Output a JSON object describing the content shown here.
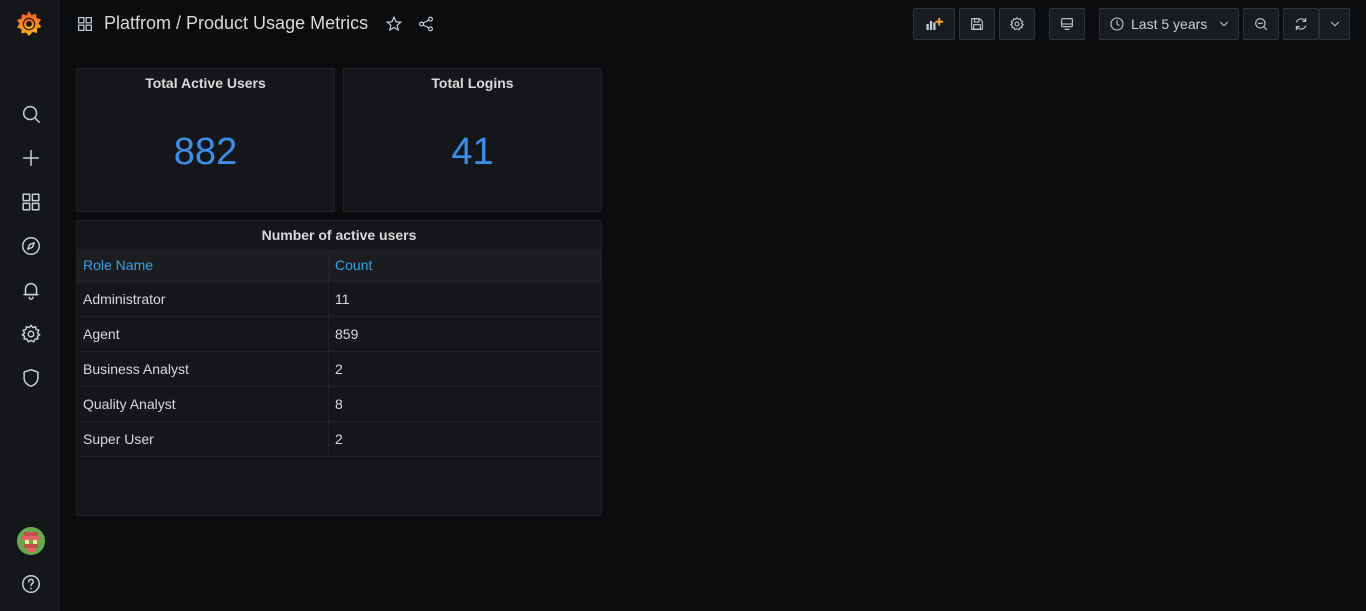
{
  "header": {
    "breadcrumb": "Platfrom / Product Usage Metrics",
    "time_range": "Last 5 years"
  },
  "panels": {
    "active_users": {
      "title": "Total Active Users",
      "value": "882"
    },
    "logins": {
      "title": "Total Logins",
      "value": "41"
    },
    "table": {
      "title": "Number of active users",
      "columns": [
        "Role Name",
        "Count"
      ],
      "rows": [
        [
          "Administrator",
          "11"
        ],
        [
          "Agent",
          "859"
        ],
        [
          "Business Analyst",
          "2"
        ],
        [
          "Quality Analyst",
          "8"
        ],
        [
          "Super User",
          "2"
        ]
      ]
    }
  },
  "colors": {
    "accent_blue": "#3d8fe6",
    "header_link": "#33a2e5",
    "logo_orange": "#f05a28"
  }
}
